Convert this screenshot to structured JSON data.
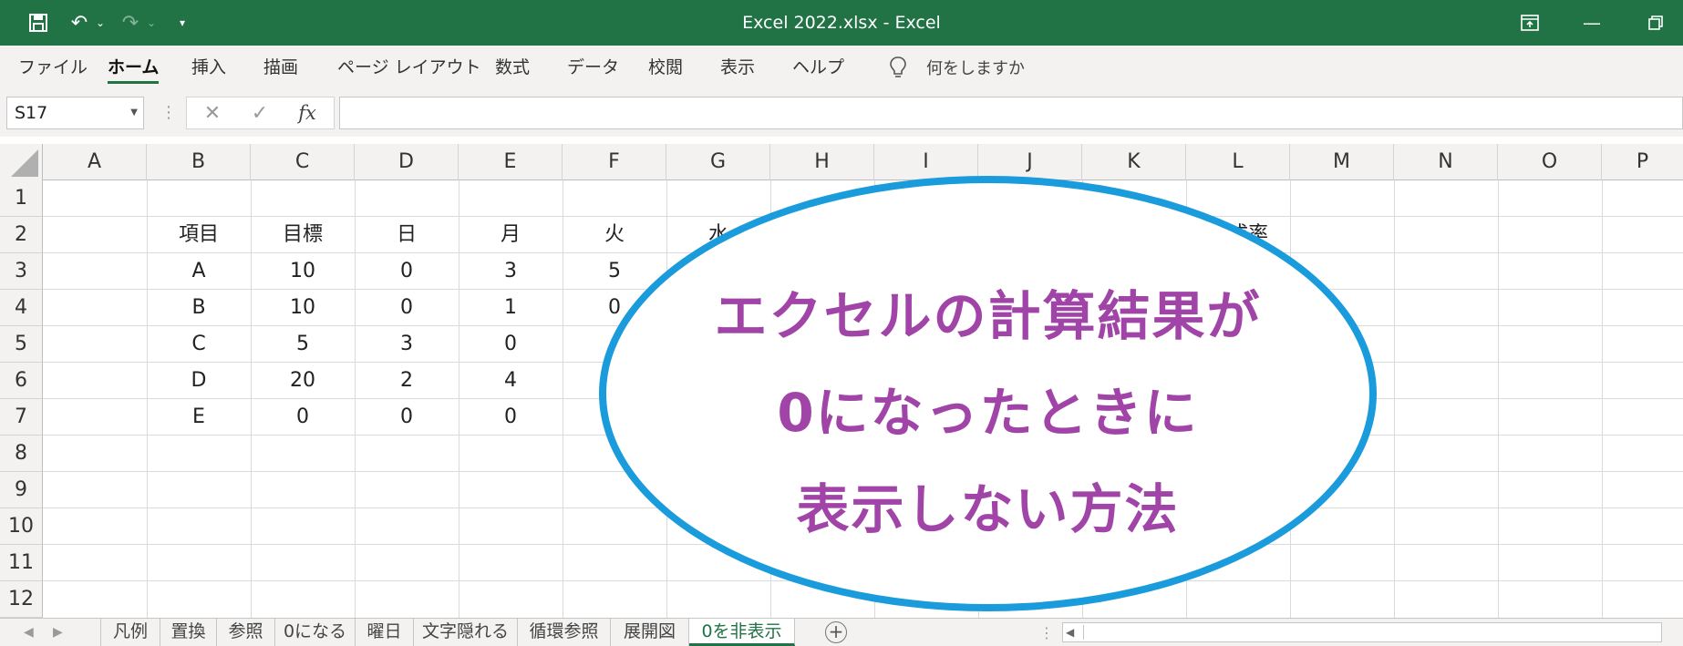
{
  "titlebar": {
    "title": "Excel 2022.xlsx  -  Excel",
    "bg_color": "#217346"
  },
  "quick_access": {
    "save_icon": "save-icon",
    "undo_icon": "undo-icon",
    "redo_icon": "redo-icon",
    "customize_icon": "customize-qat-icon"
  },
  "window_controls": {
    "ribbon_display_icon": "ribbon-display-options-icon",
    "minimize_icon": "minimize-icon",
    "restore_icon": "restore-icon"
  },
  "menu": {
    "items": [
      "ファイル",
      "ホーム",
      "挿入",
      "描画",
      "ページ レイアウト",
      "数式",
      "データ",
      "校閲",
      "表示",
      "ヘルプ"
    ],
    "active": "ホーム",
    "tell_me": "何をしますか"
  },
  "formula_bar": {
    "name_box": "S17",
    "cancel_glyph": "✕",
    "enter_glyph": "✓",
    "fx_label": "fx",
    "formula": ""
  },
  "grid": {
    "columns": [
      "A",
      "B",
      "C",
      "D",
      "E",
      "F",
      "G",
      "H",
      "I",
      "J",
      "K",
      "L",
      "M",
      "N",
      "O",
      "P"
    ],
    "rows": [
      "1",
      "2",
      "3",
      "4",
      "5",
      "6",
      "7",
      "8",
      "9",
      "10",
      "11",
      "12"
    ],
    "cells": {
      "B2": "項目",
      "C2": "目標",
      "D2": "日",
      "E2": "月",
      "F2": "火",
      "G2": "水",
      "L2": "達成率",
      "B3": "A",
      "C3": "10",
      "D3": "0",
      "E3": "3",
      "F3": "5",
      "B4": "B",
      "C4": "10",
      "D4": "0",
      "E4": "1",
      "F4": "0",
      "B5": "C",
      "C5": "5",
      "D5": "3",
      "E5": "0",
      "B6": "D",
      "C6": "20",
      "D6": "2",
      "E6": "4",
      "B7": "E",
      "C7": "0",
      "D7": "0",
      "E7": "0"
    }
  },
  "overlay": {
    "lines": [
      "エクセルの計算結果が",
      "0になったときに",
      "表示しない方法"
    ],
    "text_color": "#a144a7",
    "border_color": "#1a9bdc"
  },
  "sheet_tabs": {
    "tabs": [
      "凡例",
      "置換",
      "参照",
      "0になる",
      "曜日",
      "文字隠れる",
      "循環参照",
      "展開図",
      "0を非表示"
    ],
    "active": "0を非表示",
    "add_label": "+"
  }
}
